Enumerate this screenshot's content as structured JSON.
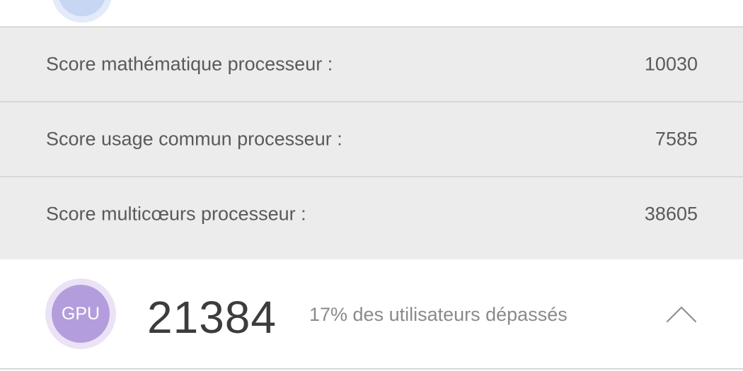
{
  "detail_rows": [
    {
      "label": "Score mathématique processeur :",
      "value": "10030"
    },
    {
      "label": "Score usage commun processeur :",
      "value": "7585"
    },
    {
      "label": "Score multicœurs processeur :",
      "value": "38605"
    }
  ],
  "gpu": {
    "badge": "GPU",
    "score": "21384",
    "percent_text": "17% des utilisateurs dépassés",
    "badge_color": "#b39ddd",
    "expanded": true
  },
  "icons": {
    "collapse": "chevron-up-icon"
  }
}
